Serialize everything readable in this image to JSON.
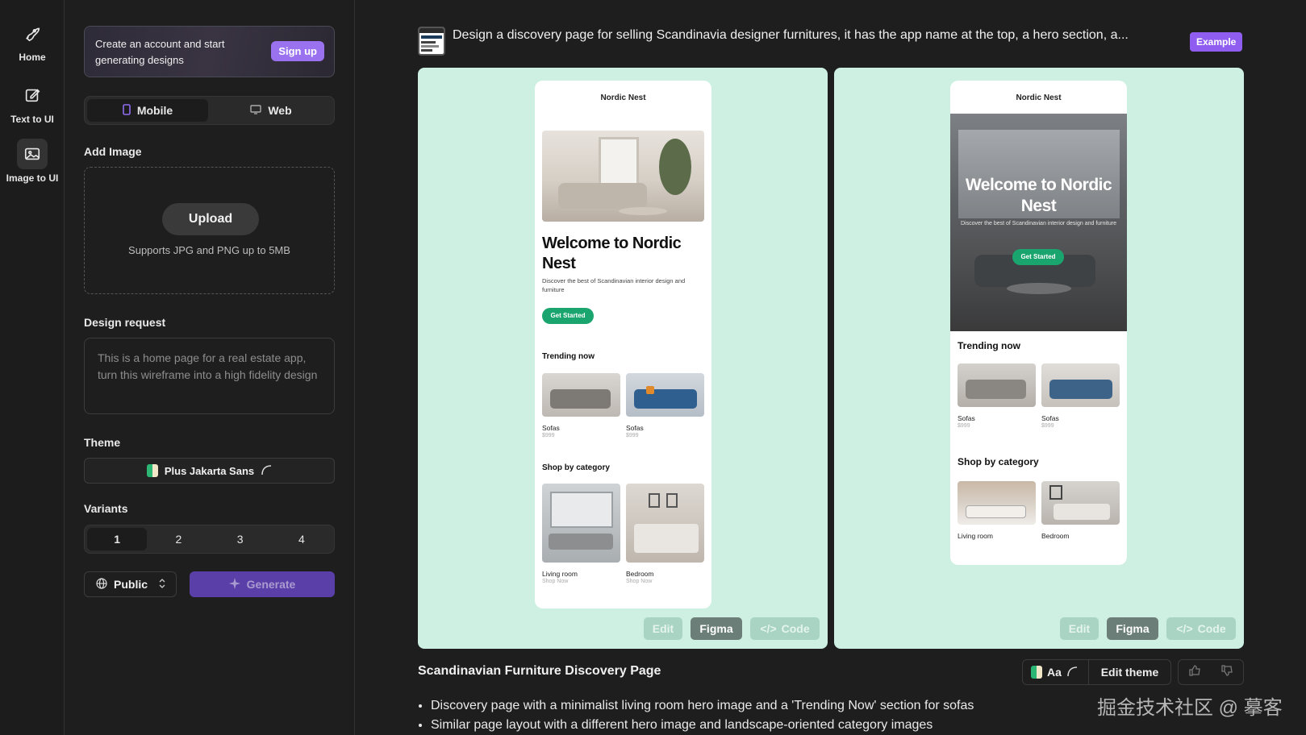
{
  "rail": {
    "items": [
      {
        "label": "Home",
        "icon": "rocket-icon"
      },
      {
        "label": "Text to UI",
        "icon": "edit-icon"
      },
      {
        "label": "Image to UI",
        "icon": "image-icon"
      }
    ]
  },
  "sidebar": {
    "promo_text": "Create an account and start generating designs",
    "signup_label": "Sign up",
    "platform_tabs": [
      {
        "label": "Mobile",
        "icon": "mobile-icon",
        "active": true
      },
      {
        "label": "Web",
        "icon": "monitor-icon",
        "active": false
      }
    ],
    "add_image_label": "Add Image",
    "upload_label": "Upload",
    "upload_note": "Supports JPG and PNG up to 5MB",
    "design_request_label": "Design request",
    "design_request_placeholder": "This is a home page for a real estate app, turn this wireframe into a high fidelity design",
    "theme_label": "Theme",
    "theme_value": "Plus Jakarta Sans",
    "variants_label": "Variants",
    "variants": [
      "1",
      "2",
      "3",
      "4"
    ],
    "variants_selected": "1",
    "visibility": "Public",
    "generate_label": "Generate"
  },
  "main": {
    "prompt": "Design a discovery page for selling Scandinavia designer furnitures, it has the app name at the top, a hero section, a...",
    "badge": "Example",
    "variant1": {
      "app_name": "Nordic Nest",
      "hero_title": "Welcome to Nordic Nest",
      "hero_desc": "Discover the best of Scandinavian interior design and furniture",
      "cta": "Get Started",
      "trending_title": "Trending now",
      "trending": [
        {
          "name": "Sofas",
          "price": "$999"
        },
        {
          "name": "Sofas",
          "price": "$999"
        }
      ],
      "category_title": "Shop by category",
      "categories": [
        {
          "name": "Living room",
          "cta": "Shop Now"
        },
        {
          "name": "Bedroom",
          "cta": "Shop Now"
        }
      ]
    },
    "variant2": {
      "app_name": "Nordic Nest",
      "hero_title": "Welcome to Nordic Nest",
      "hero_desc": "Discover the best of Scandinavian interior design and furniture",
      "cta": "Get Started",
      "trending_title": "Trending now",
      "trending": [
        {
          "name": "Sofas",
          "price": "$999"
        },
        {
          "name": "Sofas",
          "price": "$999"
        }
      ],
      "category_title": "Shop by category",
      "categories": [
        {
          "name": "Living room"
        },
        {
          "name": "Bedroom"
        }
      ]
    },
    "card_buttons": {
      "edit": "Edit",
      "figma": "Figma",
      "code": "Code"
    },
    "result_title": "Scandinavian Furniture Discovery Page",
    "bullets": [
      "Discovery page with a minimalist living room hero image and a 'Trending Now' section for sofas",
      "Similar page layout with a different hero image and landscape-oriented category images"
    ],
    "theme_pill_aa": "Aa",
    "edit_theme_label": "Edit theme",
    "watermark": "掘金技术社区 @ 摹客"
  },
  "colors": {
    "accent": "#9a72f0",
    "card_bg": "#cdf0e2",
    "cta_green": "#1aa56e"
  }
}
